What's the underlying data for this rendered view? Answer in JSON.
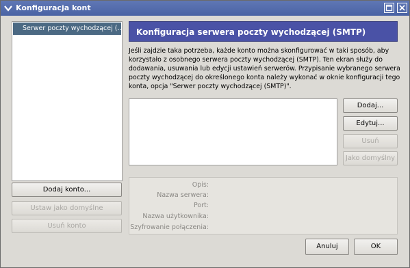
{
  "window": {
    "title": "Konfiguracja kont"
  },
  "sidebar": {
    "items": [
      {
        "label": "Serwer poczty wychodzącej (…"
      }
    ],
    "add_account_label": "Dodaj konto...",
    "set_default_label": "Ustaw jako domyślne",
    "remove_account_label": "Usuń konto"
  },
  "main": {
    "header_title": "Konfiguracja serwera poczty wychodzącej (SMTP)",
    "description_lines": [
      "Jeśli zajdzie taka potrzeba, każde konto można skonfigurować w taki sposób, aby",
      "korzystało z osobnego serwera poczty wychodzącej (SMTP). Ten ekran służy do",
      "dodawania, usuwania lub edycji ustawień serwerów. Przypisanie wybranego serwera",
      "poczty wychodzącej do określonego konta należy wykonać w oknie konfiguracji tego",
      "konta, opcja \"Serwer poczty wychodzącej (SMTP)\"."
    ],
    "buttons": {
      "add": "Dodaj...",
      "edit": "Edytuj...",
      "remove": "Usuń",
      "set_default": "Jako domyślny"
    },
    "details": {
      "description_label": "Opis:",
      "server_name_label": "Nazwa serwera:",
      "port_label": "Port:",
      "username_label": "Nazwa użytkownika:",
      "encryption_label": "Szyfrowanie połączenia:"
    }
  },
  "footer": {
    "cancel_label": "Anuluj",
    "ok_label": "OK"
  },
  "colors": {
    "titlebar": "#4f68a8",
    "header": "#4a52a6",
    "selection": "#4b6983",
    "window_bg": "#dcdad5"
  },
  "icons": [
    "window-menu-icon",
    "minimize-icon",
    "close-icon"
  ]
}
